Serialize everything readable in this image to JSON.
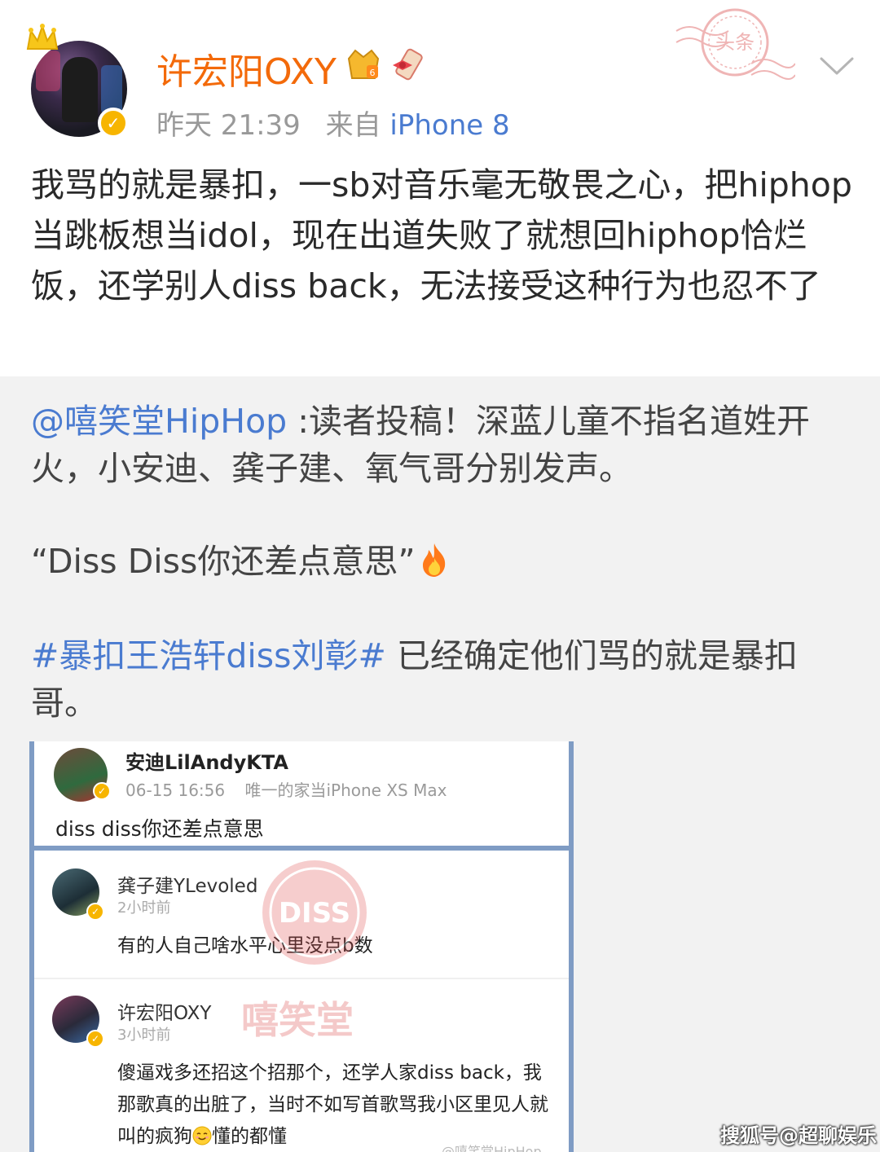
{
  "post": {
    "username": "许宏阳OXY",
    "time": "昨天 21:39",
    "source_prefix": "来自",
    "device": "iPhone 8",
    "stamp_text": "头条",
    "text": "我骂的就是暴扣，一sb对音乐毫无敬畏之心，把hiphop当跳板想当idol，现在出道失败了就想回hiphop恰烂饭，还学别人diss back，无法接受这种行为也忍不了"
  },
  "repost": {
    "mention": "@嘻笑堂HipHop",
    "text": " :读者投稿！深蓝儿童不指名道姓开火，小安迪、龚子建、氧气哥分别发声。",
    "quote": "“Diss Diss你还差点意思”",
    "hashtag": "#暴扣王浩轩diss刘彰#",
    "hashtag_text": " 已经确定他们骂的就是暴扣哥。"
  },
  "screenshot": {
    "top_post": {
      "name": "安迪LilAndyKTA",
      "time": "06-15 16:56",
      "source": "唯一的家当iPhone XS Max",
      "text": "diss diss你还差点意思"
    },
    "comments": [
      {
        "name": "龚子建YLevoled",
        "time": "2小时前",
        "text": "有的人自己啥水平心里没点b数"
      },
      {
        "name": "许宏阳OXY",
        "time": "3小时前",
        "text": "傻逼戏多还招这个招那个，还学人家diss back，我那歌真的出脏了，当时不如写首歌骂我小区里见人就叫的疯狗",
        "text_after_emoji": "懂的都懂"
      }
    ],
    "watermark_diss": "DISS",
    "watermark_brand": "嘻笑堂",
    "watermark_bottom": "@嘻笑堂HipHop"
  },
  "footer_watermark": "搜狐号@超聊娱乐",
  "colors": {
    "username": "#f36a0a",
    "link": "#4a7bd0",
    "verified": "#f7b500",
    "screenshot_border": "#7f9cc4"
  },
  "icons": [
    "crown-icon",
    "verified-icon",
    "vip-icon",
    "ribbon-icon",
    "stamp-icon",
    "chevron-down-icon",
    "fire-icon",
    "smile-icon"
  ]
}
